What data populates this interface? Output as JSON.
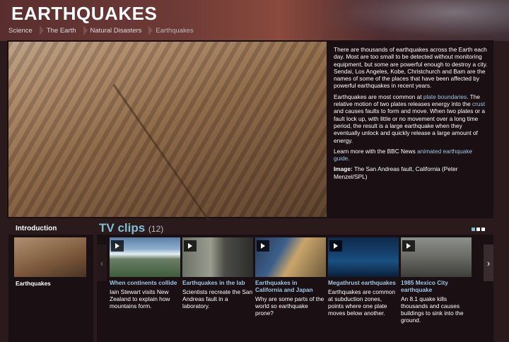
{
  "page": {
    "title": "EARTHQUAKES"
  },
  "breadcrumb": [
    "Science",
    "The Earth",
    "Natural Disasters",
    "Earthquakes"
  ],
  "feature": {
    "para1": "There are thousands of earthquakes across the Earth each day. Most are too small to be detected without monitoring equipment, but some are powerful enough to destroy a city. Sendai, Los Angeles, Kobe, Christchurch and Bam are the names of some of the places that have been affected by powerful earthquakes in recent years.",
    "para2_a": "Earthquakes are most common at ",
    "para2_link1": "plate boundaries",
    "para2_b": ". The relative motion of two plates releases energy into the ",
    "para2_link2": "crust",
    "para2_c": " and causes faults to form and move. When two plates or a fault lock up, with little or no movement over a long time period, the result is a large earthquake when they eventually unlock and quickly release a large amount of energy.",
    "para3_a": "Learn more with the BBC News ",
    "para3_link": "animated earthquake guide",
    "para3_b": ".",
    "image_label": "Image:",
    "image_credit": " The San Andreas fault, California (Peter Menzel/SPL)"
  },
  "intro": {
    "label": "Introduction",
    "caption": "Earthquakes"
  },
  "tv": {
    "title": "TV clips",
    "count": "(12)",
    "prev_glyph": "‹",
    "next_glyph": "›"
  },
  "clips": [
    {
      "title": "When continents collide",
      "desc": "Iain Stewart visits New Zealand to explain how mountains form."
    },
    {
      "title": "Earthquakes in the lab",
      "desc": "Scientists recreate the San Andreas fault in a laboratory."
    },
    {
      "title": "Earthquakes in California and Japan",
      "desc": "Why are some parts of the world so earthquake prone?"
    },
    {
      "title": "Megathrust earthquakes",
      "desc": "Earthquakes are common at subduction zones, points where one plate moves below another."
    },
    {
      "title": "1985 Mexico City earthquake",
      "desc": "An 8.1 quake kills thousands and causes buildings to sink into the ground."
    }
  ]
}
